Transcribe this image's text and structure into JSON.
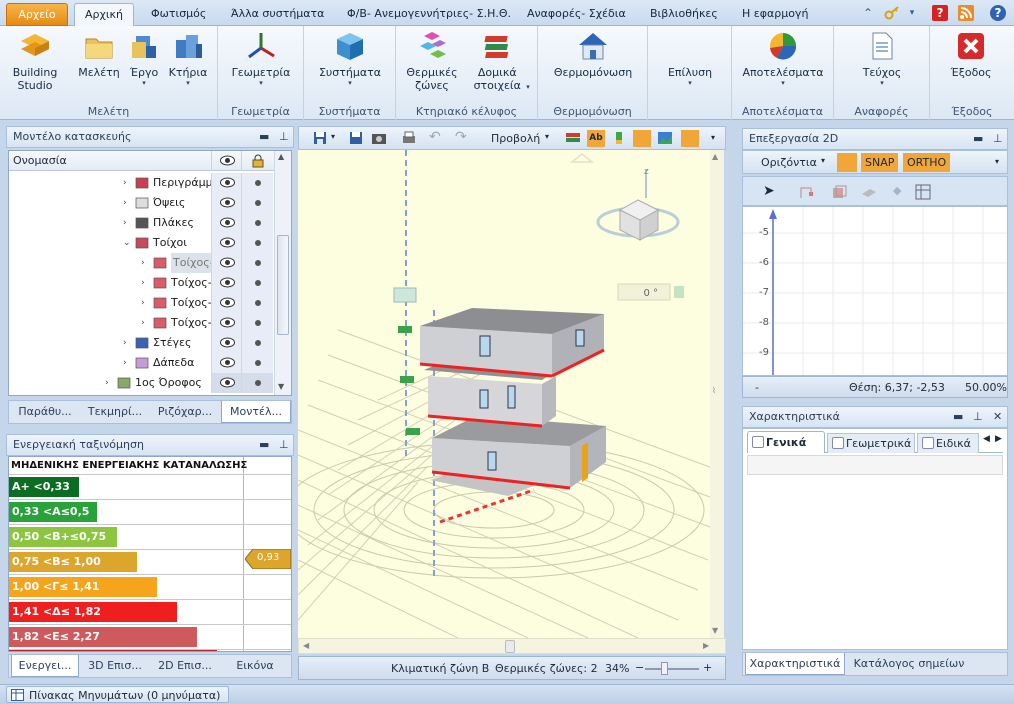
{
  "tabs": {
    "file": "Αρχείο",
    "home": "Αρχική",
    "lighting": "Φωτισμός",
    "other_systems": "Άλλα συστήματα",
    "pv": "Φ/Β- Ανεμογεννήτριες- Σ.Η.Θ.",
    "reports": "Αναφορές- Σχέδια",
    "libraries": "Βιβλιοθήκες",
    "app": "Η εφαρμογή"
  },
  "ribbon": {
    "building_studio": "Building Studio",
    "study": "Μελέτη",
    "project": "Έργο",
    "buildings": "Κτήρια",
    "geometry": "Γεωμετρία",
    "systems": "Συστήματα",
    "thermal_zones": "Θερμικές ζώνες",
    "structural": "Δομικά στοιχεία",
    "thermal_insulation": "Θερμομόνωση",
    "solve": "Επίλυση",
    "results": "Αποτελέσματα",
    "booklet": "Τεύχος",
    "exit": "Έξοδος",
    "group_study": "Μελέτη",
    "group_geometry": "Γεωμετρία",
    "group_systems": "Συστήματα",
    "group_envelope": "Κτηριακό κέλυφος",
    "group_insulation": "Θερμομόνωση",
    "group_results": "Αποτελέσματα",
    "group_reports": "Αναφορές",
    "group_exit": "Έξοδος"
  },
  "model_panel": {
    "title": "Μοντέλο κατασκευής",
    "col_name": "Ονομασία",
    "rows": [
      {
        "label": "Περιγράμμ...",
        "indent": 1,
        "arrow": "›"
      },
      {
        "label": "Όψεις",
        "indent": 1,
        "arrow": "›"
      },
      {
        "label": "Πλάκες",
        "indent": 1,
        "arrow": "›"
      },
      {
        "label": "Τοίχοι",
        "indent": 1,
        "arrow": "⌄"
      },
      {
        "label": "Τοίχος-0...",
        "indent": 2,
        "arrow": "›"
      },
      {
        "label": "Τοίχος-0...",
        "indent": 2,
        "arrow": "›"
      },
      {
        "label": "Τοίχος-0...",
        "indent": 2,
        "arrow": "›"
      },
      {
        "label": "Τοίχος-0...",
        "indent": 2,
        "arrow": "›"
      },
      {
        "label": "Στέγες",
        "indent": 1,
        "arrow": "›"
      },
      {
        "label": "Δάπεδα",
        "indent": 1,
        "arrow": "›"
      },
      {
        "label": "1ος Όροφος",
        "indent": 0,
        "arrow": "›"
      }
    ],
    "tabs": [
      "Παράθυ...",
      "Τεκμηρί...",
      "Ριζόχαρ...",
      "Μοντέλ..."
    ]
  },
  "energy_panel": {
    "title": "Ενεργειακή ταξινόμηση",
    "header": "ΜΗΔΕΝΙΚΗΣ ΕΝΕΡΓΕΙΑΚΗΣ ΚΑΤΑΝΑΛΩΣΗΣ",
    "classes": [
      {
        "label": "Α+ <0,33",
        "color": "#0b6e22"
      },
      {
        "label": "0,33 <Α≤0,5",
        "color": "#2aa23a"
      },
      {
        "label": "0,50 <Β+≤0,75",
        "color": "#8cc63e"
      },
      {
        "label": "0,75 <Β≤ 1,00",
        "color": "#dca52c"
      },
      {
        "label": "1,00 <Γ≤ 1,41",
        "color": "#f6a41c"
      },
      {
        "label": "1,41 <Δ≤ 1,82",
        "color": "#ef1f1f"
      },
      {
        "label": "1,82 <Ε≤ 2,27",
        "color": "#cf5a5e"
      }
    ],
    "indicator": "0,93",
    "tabs": [
      "Ενεργει...",
      "3D Επισ...",
      "2D Επισ...",
      "Εικόνα"
    ]
  },
  "viewport": {
    "view_label": "Προβολή",
    "angle": "0 °",
    "status_zone": "Κλιματική ζώνη Β",
    "status_thermal": "Θερμικές ζώνες: 2",
    "zoom": "34%"
  },
  "edit2d": {
    "title": "Επεξεργασία 2D",
    "mode": "Οριζόντια",
    "snap": "SNAP",
    "ortho": "ORTHO",
    "ruler": [
      "-5",
      "-6",
      "-7",
      "-8",
      "-9"
    ],
    "status_dash": "-",
    "position": "Θέση: 6,37; -2,53",
    "zoom": "50.00%"
  },
  "properties": {
    "title": "Χαρακτηριστικά",
    "tabs": [
      "Γενικά",
      "Γεωμετρικά",
      "Ειδικά"
    ],
    "bottom_tabs": [
      "Χαρακτηριστικά",
      "Κατάλογος σημείων"
    ]
  },
  "messages": "Πίνακας Μηνυμάτων (0 μηνύματα)"
}
